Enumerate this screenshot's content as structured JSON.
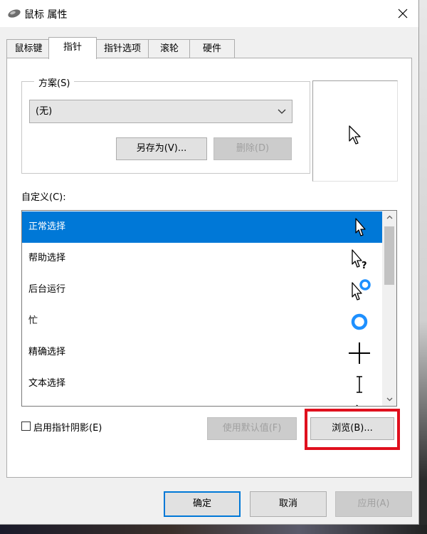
{
  "window": {
    "title": "鼠标 属性"
  },
  "tabs": [
    {
      "label": "鼠标键"
    },
    {
      "label": "指针"
    },
    {
      "label": "指针选项"
    },
    {
      "label": "滚轮"
    },
    {
      "label": "硬件"
    }
  ],
  "scheme": {
    "legend": "方案(S)",
    "selected": "(无)",
    "save_as_label": "另存为(V)...",
    "delete_label": "删除(D)"
  },
  "customize": {
    "label": "自定义(C):",
    "items": [
      {
        "label": "正常选择",
        "cursor": "arrow-cursor-icon",
        "selected": true
      },
      {
        "label": "帮助选择",
        "cursor": "help-cursor-icon",
        "selected": false
      },
      {
        "label": "后台运行",
        "cursor": "working-cursor-icon",
        "selected": false
      },
      {
        "label": "忙",
        "cursor": "busy-cursor-icon",
        "selected": false
      },
      {
        "label": "精确选择",
        "cursor": "crosshair-cursor-icon",
        "selected": false
      },
      {
        "label": "文本选择",
        "cursor": "text-cursor-icon",
        "selected": false
      },
      {
        "label": "",
        "cursor": "handwriting-cursor-icon",
        "selected": false
      }
    ]
  },
  "shadow": {
    "label": "启用指针阴影(E)",
    "checked": false
  },
  "buttons": {
    "use_default": "使用默认值(F)",
    "browse": "浏览(B)...",
    "ok": "确定",
    "cancel": "取消",
    "apply": "应用(A)"
  },
  "colors": {
    "selection": "#0078d7",
    "highlight_box": "#e0101e",
    "busy_ring": "#1e90ff"
  }
}
